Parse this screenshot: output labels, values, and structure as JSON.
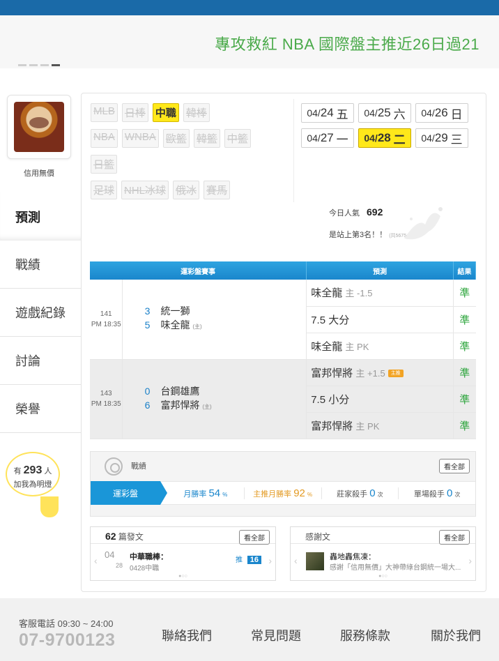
{
  "banner": {
    "text": "專攻救紅 NBA 國際盤主推近26日過21"
  },
  "profile": {
    "name": "信用無價"
  },
  "nav": [
    {
      "label": "預測"
    },
    {
      "label": "戰績"
    },
    {
      "label": "遊戲紀錄"
    },
    {
      "label": "討論"
    },
    {
      "label": "榮譽"
    }
  ],
  "fans": {
    "prefix": "有",
    "count": "293",
    "unit": "人",
    "line2": "加我為明燈"
  },
  "leagues": {
    "row1": [
      "MLB",
      "日棒",
      "中職",
      "韓棒"
    ],
    "row2": [
      "NBA",
      "WNBA",
      "歐籃",
      "韓籃",
      "中籃"
    ],
    "row3": [
      "日籃"
    ],
    "row4": [
      "足球",
      "NHL冰球",
      "俄冰",
      "賽馬"
    ],
    "selected": "中職"
  },
  "dates": [
    {
      "md": "04/",
      "d": "24",
      "wd": "五"
    },
    {
      "md": "04/",
      "d": "25",
      "wd": "六"
    },
    {
      "md": "04/",
      "d": "26",
      "wd": "日"
    },
    {
      "md": "04/",
      "d": "27",
      "wd": "一"
    },
    {
      "md": "04/",
      "d": "28",
      "wd": "二"
    },
    {
      "md": "04/",
      "d": "29",
      "wd": "三"
    }
  ],
  "popularity": {
    "label": "今日人氣",
    "value": "692",
    "rank": "是站上第3名！！",
    "rank_small": "(共5675人)"
  },
  "table": {
    "headers": {
      "game": "運彩盤賽事",
      "pred": "預測",
      "res": "結果"
    },
    "games": [
      {
        "id": "141",
        "time": "PM 18:35",
        "away_score": "3",
        "away": "統一獅",
        "home_score": "5",
        "home": "味全龍",
        "home_tag": "(主)",
        "preds": [
          {
            "team": "味全龍",
            "detail": "主 -1.5",
            "result": "準"
          },
          {
            "team": "7.5 大分",
            "detail": "",
            "result": "準"
          },
          {
            "team": "味全龍",
            "detail": "主 PK",
            "result": "準"
          }
        ]
      },
      {
        "id": "143",
        "time": "PM 18:35",
        "away_score": "0",
        "away": "台鋼雄鷹",
        "home_score": "6",
        "home": "富邦悍將",
        "home_tag": "(主)",
        "preds": [
          {
            "team": "富邦悍將",
            "detail": "主 +1.5",
            "badge": "主推",
            "result": "準"
          },
          {
            "team": "7.5 小分",
            "detail": "",
            "result": "準"
          },
          {
            "team": "富邦悍將",
            "detail": "主 PK",
            "result": "準"
          }
        ]
      }
    ]
  },
  "stats": {
    "title": "戰績",
    "view_all": "看全部",
    "tab": "運彩盤",
    "items": [
      {
        "label": "月勝率",
        "value": "54",
        "unit": "%"
      },
      {
        "label": "主推月勝率",
        "value": "92",
        "unit": "%"
      },
      {
        "label": "莊家殺手",
        "value": "0",
        "unit": "次"
      },
      {
        "label": "單場殺手",
        "value": "0",
        "unit": "次"
      }
    ]
  },
  "posts": {
    "count": "62",
    "label": "篇發文",
    "view_all": "看全部",
    "month": "04",
    "day": "28",
    "title": "中華職棒：",
    "subtitle": "0428中職",
    "push_label": "推",
    "push_count": "16"
  },
  "thanks": {
    "title": "感謝文",
    "view_all": "看全部",
    "author": "轟地轟焦凍：",
    "excerpt": "感謝「信用無價」大神帶綠台鋼統一場大..."
  },
  "footer": {
    "hotline": "客服電話 09:30 ~ 24:00",
    "phone": "07-9700123",
    "links": [
      "聯絡我們",
      "常見問題",
      "服務條款",
      "關於我們"
    ]
  }
}
